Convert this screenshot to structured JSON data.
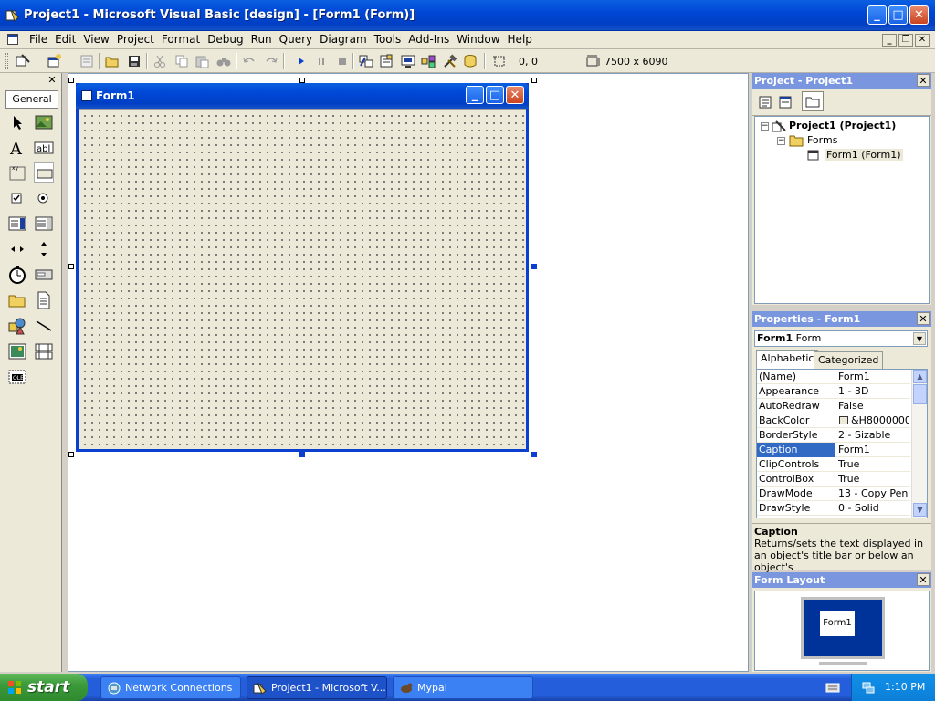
{
  "window": {
    "title": "Project1 - Microsoft Visual Basic [design] - [Form1 (Form)]"
  },
  "menu": {
    "items": [
      "File",
      "Edit",
      "View",
      "Project",
      "Format",
      "Debug",
      "Run",
      "Query",
      "Diagram",
      "Tools",
      "Add-Ins",
      "Window",
      "Help"
    ]
  },
  "toolbar": {
    "position": "0, 0",
    "size": "7500 x 6090"
  },
  "toolbox": {
    "tab_label": "General",
    "close_label": "x",
    "tools": [
      "pointer-icon",
      "picturebox-icon",
      "label-icon",
      "textbox-icon",
      "frame-icon",
      "commandbutton-icon",
      "checkbox-icon",
      "optionbutton-icon",
      "combobox-icon",
      "listbox-icon",
      "hscrollbar-icon",
      "vscrollbar-icon",
      "timer-icon",
      "drivelistbox-icon",
      "dirlistbox-icon",
      "filelistbox-icon",
      "shape-icon",
      "line-icon",
      "image-icon",
      "data-icon",
      "ole-icon"
    ]
  },
  "form": {
    "caption": "Form1"
  },
  "project_panel": {
    "title": "Project - Project1",
    "tree": {
      "root": "Project1 (Project1)",
      "folder": "Forms",
      "item": "Form1 (Form1)"
    }
  },
  "properties_panel": {
    "title": "Properties - Form1",
    "object_name": "Form1",
    "object_type": "Form",
    "tabs": [
      "Alphabetic",
      "Categorized"
    ],
    "rows": [
      {
        "name": "(Name)",
        "value": "Form1"
      },
      {
        "name": "Appearance",
        "value": "1 - 3D"
      },
      {
        "name": "AutoRedraw",
        "value": "False"
      },
      {
        "name": "BackColor",
        "value": "&H8000000F"
      },
      {
        "name": "BorderStyle",
        "value": "2 - Sizable"
      },
      {
        "name": "Caption",
        "value": "Form1"
      },
      {
        "name": "ClipControls",
        "value": "True"
      },
      {
        "name": "ControlBox",
        "value": "True"
      },
      {
        "name": "DrawMode",
        "value": "13 - Copy Pen"
      },
      {
        "name": "DrawStyle",
        "value": "0 - Solid"
      }
    ],
    "selected_row": "Caption",
    "description_title": "Caption",
    "description_text": "Returns/sets the text displayed in an object's title bar or below an object's"
  },
  "layout_panel": {
    "title": "Form Layout",
    "form_label": "Form1"
  },
  "taskbar": {
    "start_label": "start",
    "tasks": [
      "Network Connections",
      "Project1 - Microsoft V...",
      "Mypal"
    ],
    "clock": "1:10 PM"
  },
  "colors": {
    "titlebar": "#0047d6",
    "panel_title": "#7a96df",
    "selection": "#316ac5",
    "taskbar": "#245edb",
    "start": "#3c9a3a"
  }
}
